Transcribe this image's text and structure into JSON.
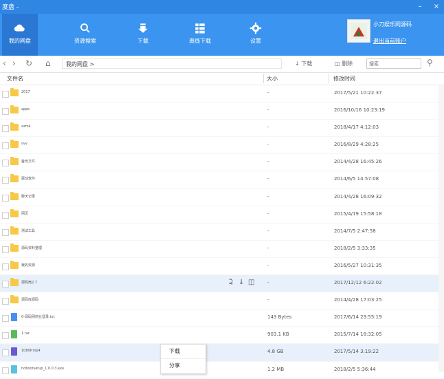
{
  "window": {
    "title": "度盘 -"
  },
  "nav": {
    "items": [
      {
        "label": "我的网盘",
        "icon": "cloud-icon"
      },
      {
        "label": "资源搜索",
        "icon": "search-icon"
      },
      {
        "label": "下载",
        "icon": "download-icon"
      },
      {
        "label": "离线下载",
        "icon": "list-icon"
      },
      {
        "label": "设置",
        "icon": "gear-icon"
      }
    ],
    "user_name": "小刀娱乐网源码",
    "logout": "退出当前账户"
  },
  "toolbar": {
    "path": "我的网盘 >",
    "download": "下载",
    "delete": "删除",
    "search_placeholder": "搜索"
  },
  "columns": {
    "name": "文件名",
    "size": "大小",
    "date": "修改时间"
  },
  "files": [
    {
      "name": "2017",
      "size": "-",
      "date": "2017/5/21 10:22:37",
      "type": "folder"
    },
    {
      "name": "apps",
      "size": "-",
      "date": "2016/10/16 10:23:19",
      "type": "folder"
    },
    {
      "name": "azmk",
      "size": "-",
      "date": "2018/4/17 4:12:03",
      "type": "folder"
    },
    {
      "name": "vvv",
      "size": "-",
      "date": "2016/8/29 4:28:25",
      "type": "folder"
    },
    {
      "name": "备份文件",
      "size": "-",
      "date": "2014/4/28 16:45:26",
      "type": "folder"
    },
    {
      "name": "驱动软件",
      "size": "-",
      "date": "2014/6/5 14:57:08",
      "type": "folder"
    },
    {
      "name": "聊天记录",
      "size": "-",
      "date": "2014/4/28 16:09:32",
      "type": "folder"
    },
    {
      "name": "网页",
      "size": "-",
      "date": "2015/4/19 15:58:18",
      "type": "folder"
    },
    {
      "name": "测试工具",
      "size": "-",
      "date": "2014/7/5 2:47:58",
      "type": "folder"
    },
    {
      "name": "源码资料整理",
      "size": "-",
      "date": "2018/2/5 3:33:35",
      "type": "folder"
    },
    {
      "name": "我的资源",
      "size": "-",
      "date": "2016/5/27 10:31:35",
      "type": "folder"
    },
    {
      "name": "源码壳2.7",
      "size": "-",
      "date": "2017/12/12 6:22:02",
      "type": "folder",
      "highlight": true
    },
    {
      "name": "源码库源码",
      "size": "-",
      "date": "2014/4/28 17:03:25",
      "type": "folder"
    },
    {
      "name": "0-源码网商业登录.txt",
      "size": "143 Bytes",
      "date": "2017/6/14 23:55:19",
      "type": "doc"
    },
    {
      "name": "1.rar",
      "size": "903.1 KB",
      "date": "2015/7/14 18:32:05",
      "type": "apk"
    },
    {
      "name": "1080P.mp4",
      "size": "4.8 GB",
      "date": "2017/5/14 3:19:22",
      "type": "video",
      "highlight": true
    },
    {
      "name": "hdbootsetup_1.0.0.3.exe",
      "size": "1.2 MB",
      "date": "2018/2/5 5:36:44",
      "type": "exe"
    }
  ],
  "context_menu": [
    "下载",
    "分享"
  ],
  "colors": {
    "nav_bg": "#3b94ef",
    "nav_active": "#2a78d4",
    "titlebar": "#2f86e3",
    "folder": "#f7c948",
    "row_highlight": "#e8f0fb"
  }
}
